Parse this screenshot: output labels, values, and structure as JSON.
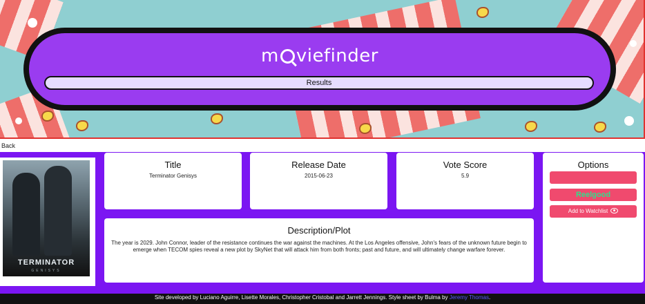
{
  "header": {
    "logo_prefix": "m",
    "logo_suffix": "viefinder",
    "results_label": "Results"
  },
  "nav": {
    "back_label": "Back"
  },
  "poster": {
    "title": "TERMINATOR",
    "subtitle": "GENISYS"
  },
  "movie": {
    "title_heading": "Title",
    "title_value": "Terminator Genisys",
    "release_heading": "Release Date",
    "release_value": "2015-06-23",
    "vote_heading": "Vote Score",
    "vote_value": "5.9",
    "description_heading": "Description/Plot",
    "description_value": "The year is 2029. John Connor, leader of the resistance continues the war against the machines. At the Los Angeles offensive, John's fears of the unknown future begin to emerge when TECOM spies reveal a new plot by SkyNet that will attack him from both fronts; past and future, and will ultimately change warfare forever."
  },
  "options": {
    "heading": "Options",
    "reelgood_label": "Reelgood",
    "watchlist_label": "Add to Watchlist"
  },
  "footer": {
    "text": "Site developed by Luciano Aguirre, Lisette Morales, Christopher Cristobal and Jarrett Jennings. Style sheet by Bulma by ",
    "author_link": "Jeremy Thomas",
    "end": "."
  },
  "colors": {
    "banner_bg": "#8fcfd1",
    "pill_bg": "#9a3cf0",
    "content_bg": "#7b16f2",
    "button_pink": "#f04a6e",
    "reelgood_green": "#2fe08c"
  }
}
